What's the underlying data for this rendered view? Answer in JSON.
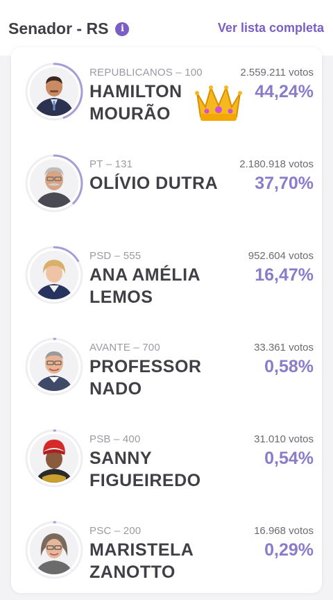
{
  "header": {
    "title": "Senador - RS",
    "info_icon_glyph": "i",
    "see_all_label": "Ver lista completa"
  },
  "colors": {
    "accent": "#7a5ec4",
    "percent": "#8b7cc9",
    "ring": "#a89cd6"
  },
  "candidates": [
    {
      "party": "REPUBLICANOS – 100",
      "name": "HAMILTON MOURÃO",
      "votes": "2.559.211 votos",
      "percent": "44,24%",
      "share": 0.4424,
      "winner": true,
      "icon": "crown-icon"
    },
    {
      "party": "PT – 131",
      "name": "OLÍVIO DUTRA",
      "votes": "2.180.918 votos",
      "percent": "37,70%",
      "share": 0.377,
      "winner": false
    },
    {
      "party": "PSD – 555",
      "name": "ANA AMÉLIA LEMOS",
      "votes": "952.604 votos",
      "percent": "16,47%",
      "share": 0.1647,
      "winner": false
    },
    {
      "party": "AVANTE – 700",
      "name": "PROFESSOR NADO",
      "votes": "33.361 votos",
      "percent": "0,58%",
      "share": 0.0058,
      "winner": false
    },
    {
      "party": "PSB – 400",
      "name": "SANNY FIGUEIREDO",
      "votes": "31.010 votos",
      "percent": "0,54%",
      "share": 0.0054,
      "winner": false
    },
    {
      "party": "PSC – 200",
      "name": "MARISTELA ZANOTTO",
      "votes": "16.968 votos",
      "percent": "0,29%",
      "share": 0.0029,
      "winner": false
    }
  ]
}
